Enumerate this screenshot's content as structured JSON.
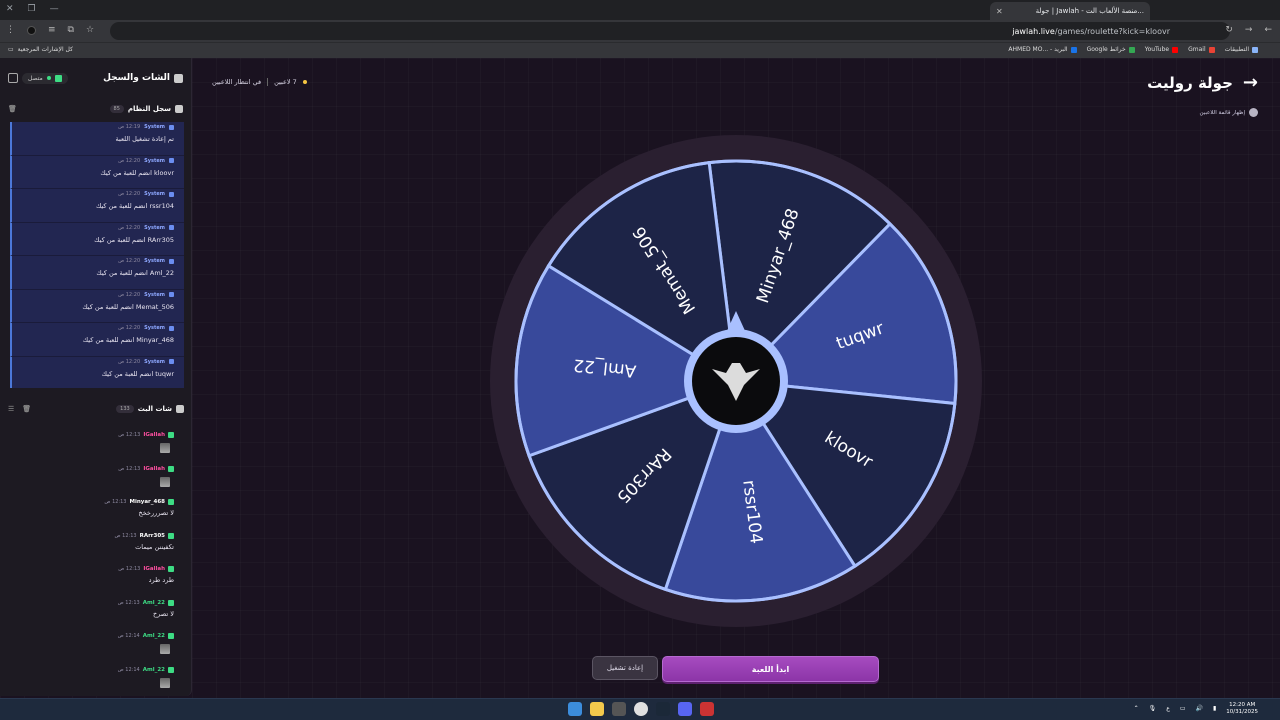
{
  "browser": {
    "tab_title": "جولة | Jawlah - منصة الألعاب الت...",
    "url_host": "jawlah.live",
    "url_path": "/games/roulette?kick=kloovr",
    "bookmarks": [
      "التطبيقات",
      "Gmail",
      "YouTube",
      "خرائط Google",
      "البريد - ...AHMED MO"
    ],
    "all_bookmarks": "كل الإشارات المرجعية"
  },
  "sidebar": {
    "title": "الشات والسجل",
    "status": "متصل",
    "system_log": {
      "title": "سجل النظام",
      "count": "85",
      "items": [
        {
          "sender": "System",
          "time": "12:19 ص",
          "text": "تم إعادة تشغيل اللعبة"
        },
        {
          "sender": "System",
          "time": "12:20 ص",
          "text": "kloovr انضم للعبة من كيك"
        },
        {
          "sender": "System",
          "time": "12:20 ص",
          "text": "rssr104 انضم للعبة من كيك"
        },
        {
          "sender": "System",
          "time": "12:20 ص",
          "text": "RArr305 انضم للعبة من كيك"
        },
        {
          "sender": "System",
          "time": "12:20 ص",
          "text": "Aml_22 انضم للعبة من كيك"
        },
        {
          "sender": "System",
          "time": "12:20 ص",
          "text": "Memat_506 انضم للعبة من كيك"
        },
        {
          "sender": "System",
          "time": "12:20 ص",
          "text": "Minyar_468 انضم للعبة من كيك"
        },
        {
          "sender": "System",
          "time": "12:20 ص",
          "text": "tuqwr انضم للعبة من كيك"
        }
      ]
    },
    "live_chat": {
      "title": "شات البث",
      "count": "133",
      "items": [
        {
          "user": "IGallah",
          "time": "12:13 ص",
          "text": "",
          "color": "#ff4fa0",
          "image": true
        },
        {
          "user": "IGallah",
          "time": "12:13 ص",
          "text": "",
          "color": "#ff4fa0",
          "image": true
        },
        {
          "user": "Minyar_468",
          "time": "12:13 ص",
          "text": "لا تصرررخخخ",
          "color": "#ffffff",
          "image": false
        },
        {
          "user": "RArr305",
          "time": "12:13 ص",
          "text": "تكفيننن ميمات",
          "color": "#ffffff",
          "image": false
        },
        {
          "user": "IGallah",
          "time": "12:13 ص",
          "text": "طرد طرد",
          "color": "#ff4fa0",
          "image": false
        },
        {
          "user": "Aml_22",
          "time": "12:13 ص",
          "text": "لا تصرخ",
          "color": "#3ddc84",
          "image": false
        },
        {
          "user": "Aml_22",
          "time": "12:14 ص",
          "text": "",
          "color": "#3ddc84",
          "image": true
        },
        {
          "user": "Aml_22",
          "time": "12:14 ص",
          "text": "",
          "color": "#3ddc84",
          "image": true
        }
      ]
    }
  },
  "main": {
    "title": "جولة روليت",
    "show_players": "إظهار قائمة اللاعبين",
    "players_count": "7 لاعبين",
    "waiting": "في انتظار اللاعبين",
    "start_button": "ابدأ اللعبة",
    "reset_button": "إعادة تشغيل"
  },
  "wheel": {
    "segments": [
      "Minyar_468",
      "tuqwr",
      "kloovr",
      "rssr104",
      "RArr305",
      "Aml_22",
      "Memat_506"
    ],
    "colors": {
      "light": "#38499b",
      "dark": "#1d2447",
      "rim": "#2a1f30",
      "border": "#a9c0ff"
    }
  },
  "taskbar": {
    "time": "12:20 AM",
    "date": "10/31/2025",
    "lang": "ع"
  }
}
